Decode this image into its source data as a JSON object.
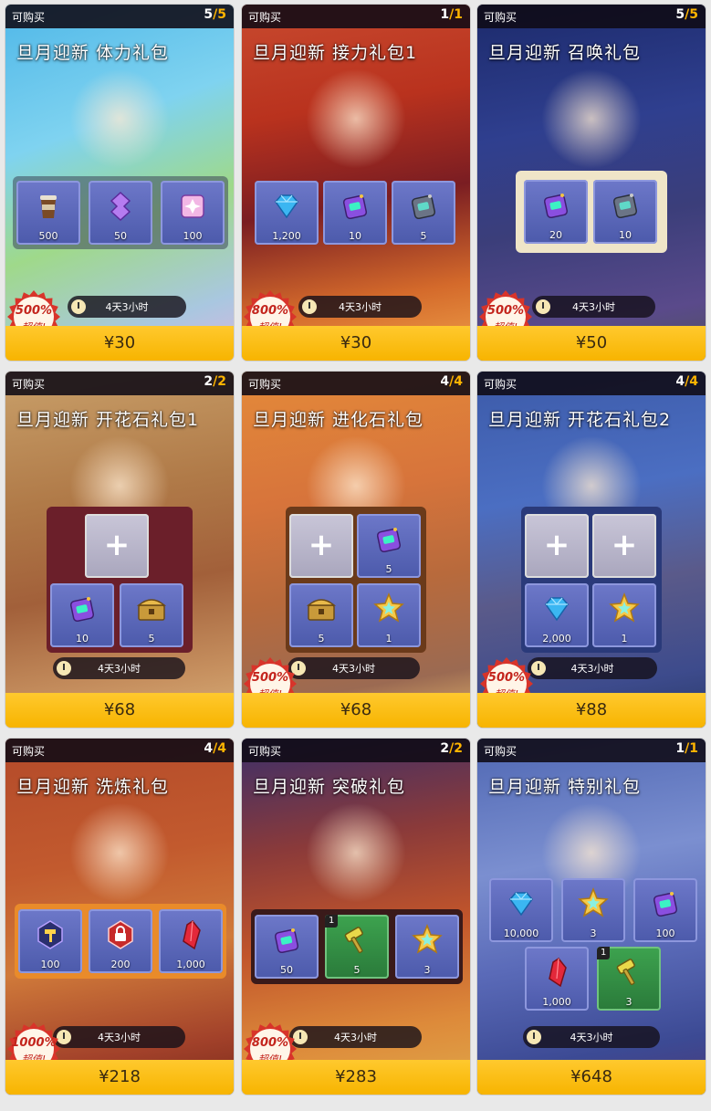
{
  "cards": [
    {
      "buyable": "可购买",
      "count_sold": "5",
      "count_sep": "/",
      "count_total": "5",
      "title": "旦月迎新 体力礼包",
      "timer": "4天3小时",
      "badge_pct": "500%",
      "badge_sub": "超值!",
      "price": "¥30",
      "items": [
        {
          "icon": "coffee-icon",
          "qty": "500"
        },
        {
          "icon": "purple-crystal-icon",
          "qty": "50"
        },
        {
          "icon": "rainbow-gem-box-icon",
          "qty": "100"
        }
      ]
    },
    {
      "buyable": "可购买",
      "count_sold": "1",
      "count_sep": "/",
      "count_total": "1",
      "title": "旦月迎新 接力礼包1",
      "timer": "4天3小时",
      "badge_pct": "800%",
      "badge_sub": "超值!",
      "price": "¥30",
      "items": [
        {
          "icon": "diamond-icon",
          "qty": "1,200"
        },
        {
          "icon": "purple-device-icon",
          "qty": "10"
        },
        {
          "icon": "gray-device-icon",
          "qty": "5"
        }
      ]
    },
    {
      "buyable": "可购买",
      "count_sold": "5",
      "count_sep": "/",
      "count_total": "5",
      "title": "旦月迎新 召唤礼包",
      "timer": "4天3小时",
      "badge_pct": "500%",
      "badge_sub": "超值!",
      "price": "¥50",
      "items": [
        {
          "icon": "purple-device-icon",
          "qty": "20"
        },
        {
          "icon": "gray-device-icon",
          "qty": "10"
        }
      ]
    },
    {
      "buyable": "可购买",
      "count_sold": "2",
      "count_sep": "/",
      "count_total": "2",
      "title": "旦月迎新 开花石礼包1",
      "timer": "4天3小时",
      "price": "¥68",
      "items": [
        {
          "icon": "plus-icon",
          "qty": "+"
        },
        {
          "icon": "purple-device-icon",
          "qty": "10"
        },
        {
          "icon": "treasure-chest-icon",
          "qty": "5"
        }
      ]
    },
    {
      "buyable": "可购买",
      "count_sold": "4",
      "count_sep": "/",
      "count_total": "4",
      "title": "旦月迎新 进化石礼包",
      "timer": "4天3小时",
      "badge_pct": "500%",
      "badge_sub": "超值!",
      "price": "¥68",
      "items": [
        {
          "icon": "plus-icon",
          "qty": "+"
        },
        {
          "icon": "purple-device-icon",
          "qty": "5"
        },
        {
          "icon": "treasure-chest-icon",
          "qty": "5"
        },
        {
          "icon": "rainbow-star-icon",
          "qty": "1"
        }
      ]
    },
    {
      "buyable": "可购买",
      "count_sold": "4",
      "count_sep": "/",
      "count_total": "4",
      "title": "旦月迎新 开花石礼包2",
      "timer": "4天3小时",
      "badge_pct": "500%",
      "badge_sub": "超值!",
      "price": "¥88",
      "items": [
        {
          "icon": "plus-icon",
          "qty": "+"
        },
        {
          "icon": "plus-icon",
          "qty": "+"
        },
        {
          "icon": "diamond-icon",
          "qty": "2,000"
        },
        {
          "icon": "rainbow-star-icon",
          "qty": "1"
        }
      ]
    },
    {
      "buyable": "可购买",
      "count_sold": "4",
      "count_sep": "/",
      "count_total": "4",
      "title": "旦月迎新 洗炼礼包",
      "timer": "4天3小时",
      "badge_pct": "1000%",
      "badge_sub": "超值!",
      "price": "¥218",
      "items": [
        {
          "icon": "hammer-gem-icon",
          "qty": "100"
        },
        {
          "icon": "red-lock-gem-icon",
          "qty": "200"
        },
        {
          "icon": "red-crystal-icon",
          "qty": "1,000"
        }
      ]
    },
    {
      "buyable": "可购买",
      "count_sold": "2",
      "count_sep": "/",
      "count_total": "2",
      "title": "旦月迎新 突破礼包",
      "timer": "4天3小时",
      "badge_pct": "800%",
      "badge_sub": "超值!",
      "price": "¥283",
      "items": [
        {
          "icon": "purple-device-icon",
          "qty": "50"
        },
        {
          "icon": "golden-hammer-icon",
          "qty": "5",
          "limit": "1"
        },
        {
          "icon": "rainbow-star-icon",
          "qty": "3"
        }
      ]
    },
    {
      "buyable": "可购买",
      "count_sold": "1",
      "count_sep": "/",
      "count_total": "1",
      "title": "旦月迎新 特别礼包",
      "timer": "4天3小时",
      "price": "¥648",
      "items": [
        {
          "icon": "diamond-icon",
          "qty": "10,000"
        },
        {
          "icon": "rainbow-star-icon",
          "qty": "3"
        },
        {
          "icon": "purple-device-icon",
          "qty": "100"
        },
        {
          "icon": "red-crystal-icon",
          "qty": "1,000"
        },
        {
          "icon": "golden-hammer-icon",
          "qty": "3",
          "limit": "1"
        }
      ]
    }
  ],
  "colors": {
    "price_bar": "#f7b400",
    "item_tile": "#5563b4",
    "count_accent": "#ffb400",
    "badge_red": "#c3241c"
  }
}
